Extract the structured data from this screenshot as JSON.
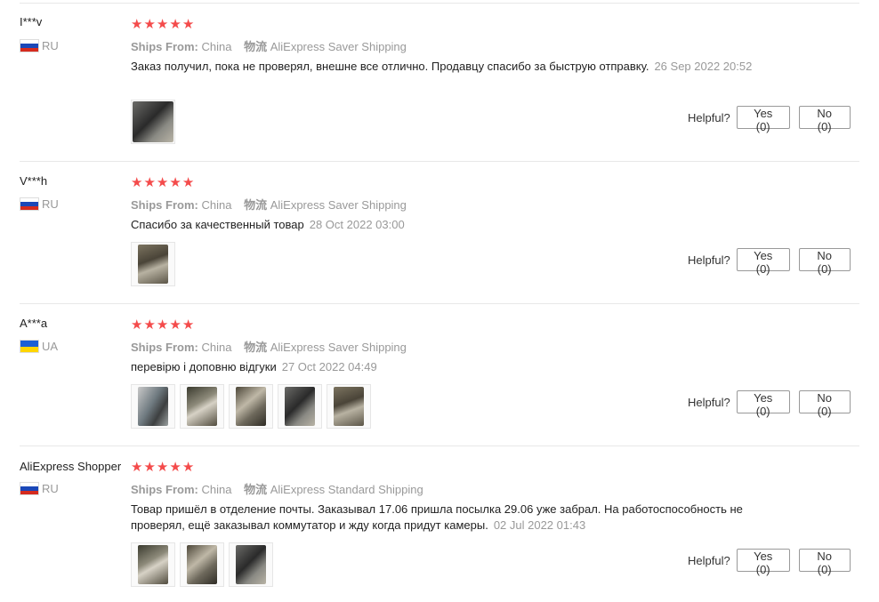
{
  "labels": {
    "ships_from": "Ships From:",
    "logistics": "物流",
    "helpful": "Helpful?"
  },
  "colors": {
    "star": "#f44b4b",
    "muted_text": "#999999",
    "divider": "#e8e8e8"
  },
  "reviews": [
    {
      "user": "I***v",
      "country": "RU",
      "flag": [
        "#ffffff",
        "#1a47b8",
        "#d52b1e"
      ],
      "rating": 5,
      "ships_from": "China",
      "shipping": "AliExpress Saver Shipping",
      "text": "Заказ получил, пока не проверял, внешне все отлично. Продавцу спасибо за быструю отправку.",
      "date": "26 Sep 2022 20:52",
      "yes": "Yes (0)",
      "no": "No (0)",
      "photos": 1
    },
    {
      "user": "V***h",
      "country": "RU",
      "flag": [
        "#ffffff",
        "#1a47b8",
        "#d52b1e"
      ],
      "rating": 5,
      "ships_from": "China",
      "shipping": "AliExpress Saver Shipping",
      "text": "Спасибо за качественный товар",
      "date": "28 Oct 2022 03:00",
      "yes": "Yes (0)",
      "no": "No (0)",
      "photos": 1
    },
    {
      "user": "A***a",
      "country": "UA",
      "flag": [
        "#1a5fd6",
        "#ffd500"
      ],
      "rating": 5,
      "ships_from": "China",
      "shipping": "AliExpress Saver Shipping",
      "text": "перевірю і доповню відгуки",
      "date": "27 Oct 2022 04:49",
      "yes": "Yes (0)",
      "no": "No (0)",
      "photos": 5
    },
    {
      "user": "AliExpress Shopper",
      "country": "RU",
      "flag": [
        "#ffffff",
        "#1a47b8",
        "#d52b1e"
      ],
      "rating": 5,
      "ships_from": "China",
      "shipping": "AliExpress Standard Shipping",
      "text": "Товар пришёл в отделение почты. Заказывал 17.06 пришла посылка 29.06 уже забрал. На работоспособность не проверял, ещё заказывал коммутатор и жду когда придут камеры.",
      "date": "02 Jul 2022 01:43",
      "yes": "Yes (0)",
      "no": "No (0)",
      "photos": 3
    }
  ]
}
